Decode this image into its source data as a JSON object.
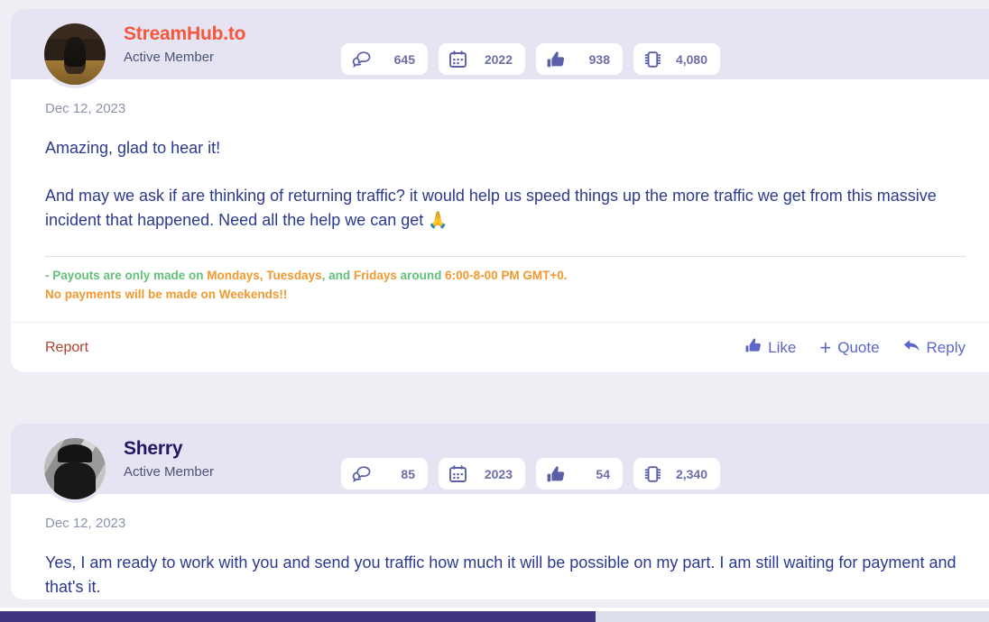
{
  "theme": {
    "page_background": "#eeeef4",
    "card_background": "#ffffff",
    "header_band": "#e6e4f3",
    "body_text": "#2b3a8f",
    "muted_text": "#8b93ab",
    "accent_username": "#f4573b",
    "accent_username_alt": "#241663",
    "action_link": "#5b66c6",
    "report_link": "#b0412f",
    "signature_green": "#63c07a",
    "signature_orange": "#f0992f",
    "badge_value": "#6b6ea8",
    "scrollbar_thumb": "#3f3580",
    "scrollbar_track": "#dcdee9"
  },
  "posts": [
    {
      "username": "StreamHub.to",
      "usertitle": "Active Member",
      "date": "Dec 12, 2023",
      "stats": [
        {
          "icon": "messages-icon",
          "value": "645"
        },
        {
          "icon": "calendar-icon",
          "value": "2022"
        },
        {
          "icon": "thumbs-up-icon",
          "value": "938"
        },
        {
          "icon": "chip-icon",
          "value": "4,080"
        }
      ],
      "paragraphs": [
        "Amazing, glad to hear it!",
        "And may we ask if are thinking of returning traffic? it would help us speed things up the more traffic we get from this massive incident that happened. Need all the help we can get 🙏"
      ],
      "signature": {
        "line1_a": "- Payouts are only made on ",
        "line1_b": "Mondays, Tuesdays",
        "line1_c": ", and ",
        "line1_d": "Fridays",
        "line1_e": " around ",
        "line1_f": "6:00-8-00 PM GMT+0.",
        "line2": "No payments will be made on Weekends!!"
      },
      "actions": {
        "report": "Report",
        "like": "Like",
        "quote": "Quote",
        "reply": "Reply"
      }
    },
    {
      "username": "Sherry",
      "usertitle": "Active Member",
      "date": "Dec 12, 2023",
      "stats": [
        {
          "icon": "messages-icon",
          "value": "85"
        },
        {
          "icon": "calendar-icon",
          "value": "2023"
        },
        {
          "icon": "thumbs-up-icon",
          "value": "54"
        },
        {
          "icon": "chip-icon",
          "value": "2,340"
        }
      ],
      "paragraphs": [
        "Yes, I am ready to work with you and send you traffic how much it will be possible on my part. I am still waiting for payment and that's it."
      ]
    }
  ]
}
